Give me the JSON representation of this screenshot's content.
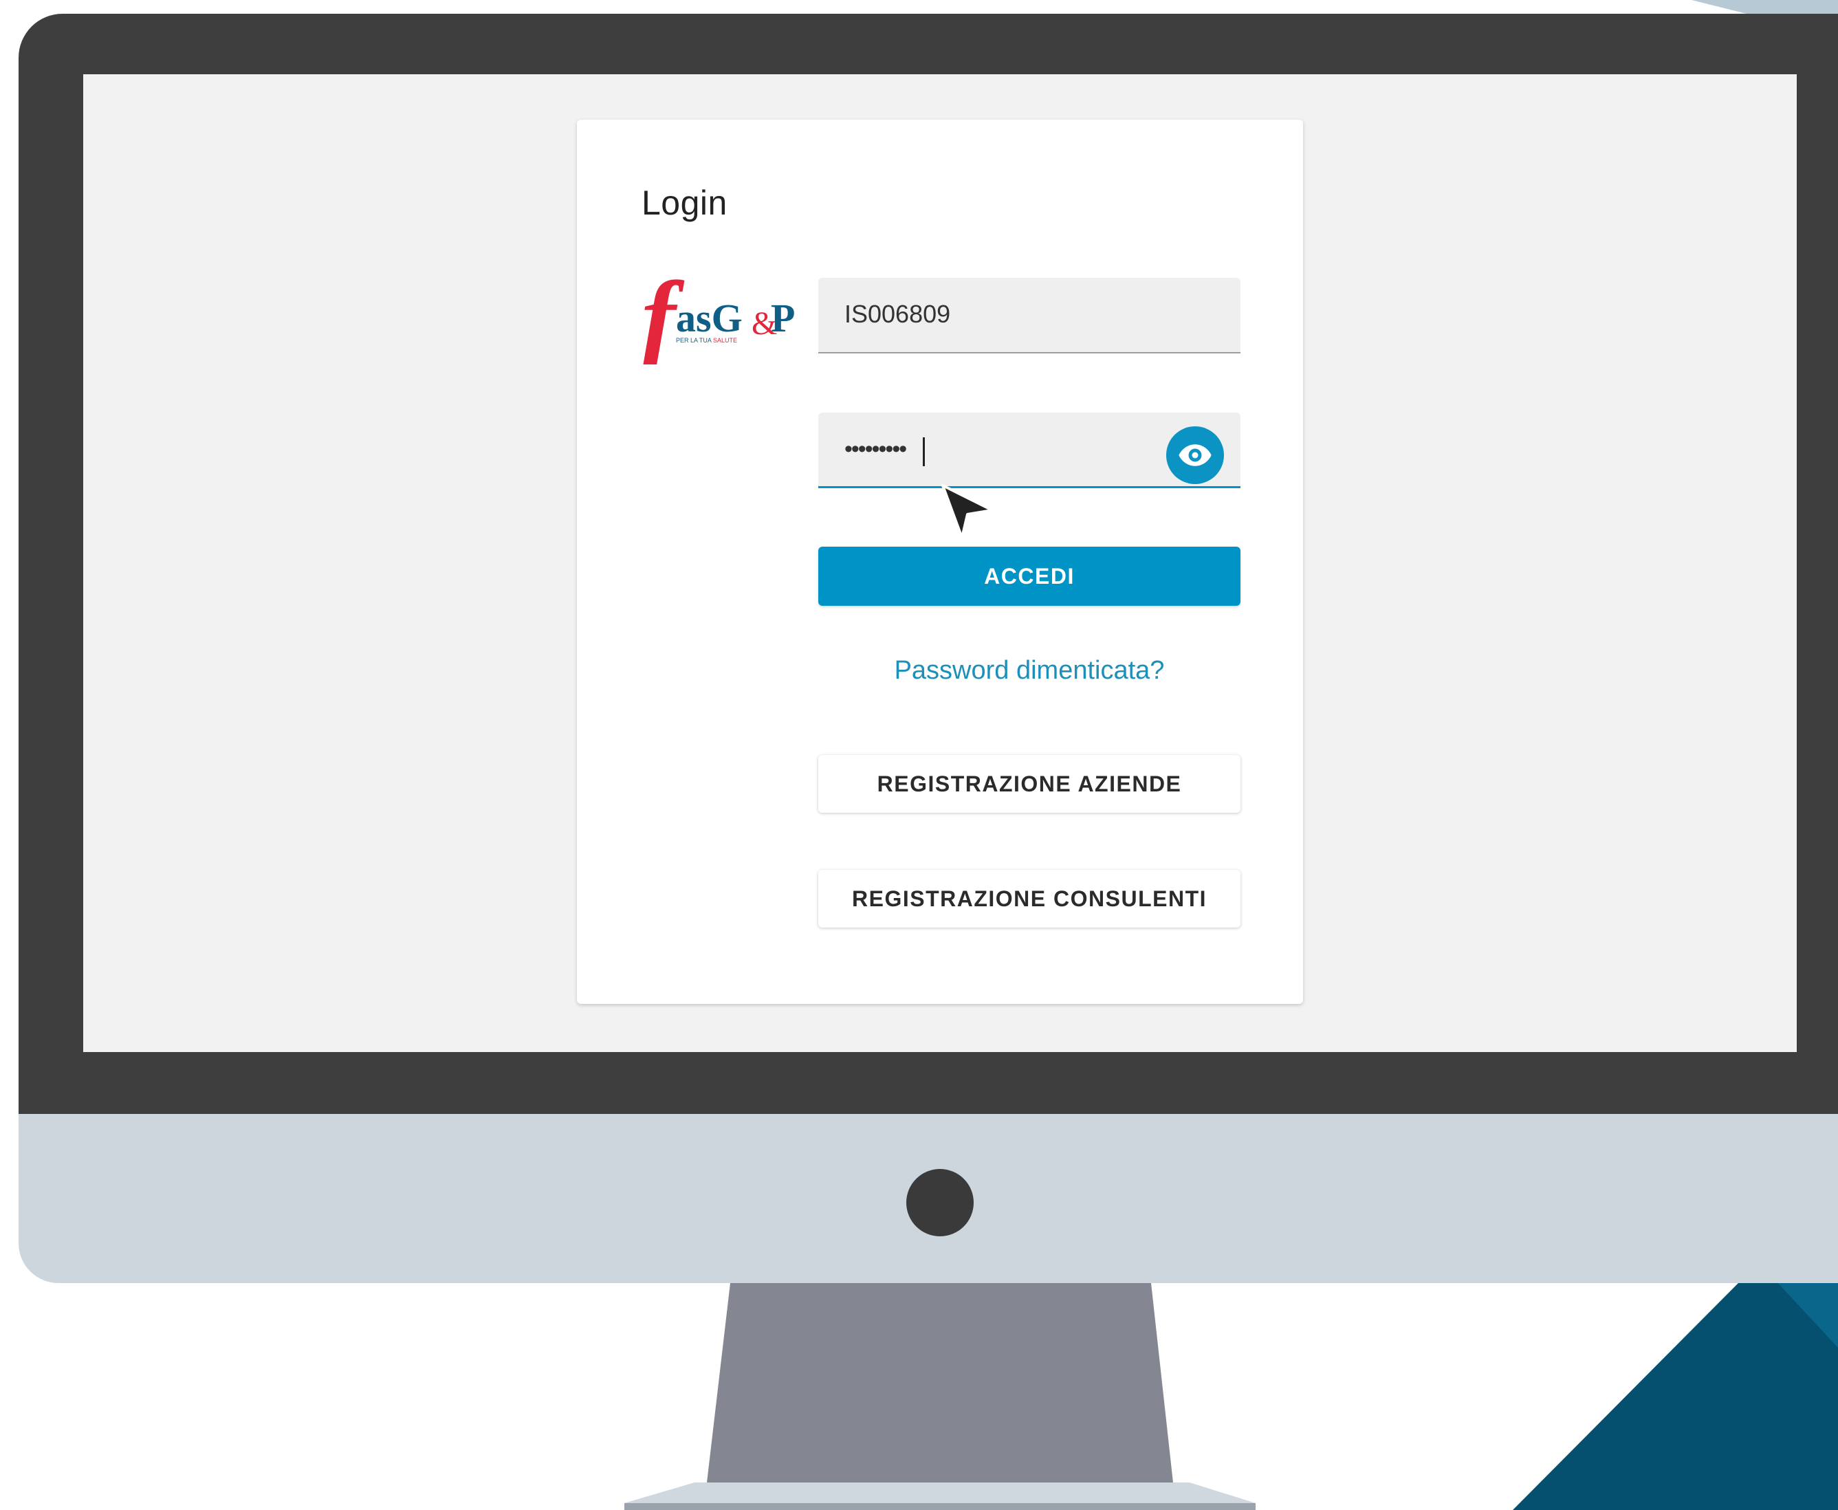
{
  "login": {
    "title": "Login",
    "logo_text": "fasG&P",
    "logo_tagline": "PER LA TUA SALUTE",
    "username_value": "IS006809",
    "password_value": "•••••••••",
    "toggle_password_icon": "eye-icon",
    "submit_label": "ACCEDI",
    "forgot_password_label": "Password dimenticata?",
    "register_companies_label": "REGISTRAZIONE AZIENDE",
    "register_consultants_label": "REGISTRAZIONE CONSULENTI"
  },
  "colors": {
    "accent": "#0093c6",
    "link": "#1c8fbb",
    "logo_red": "#e3263b",
    "logo_blue": "#0f5e86",
    "bezel": "#3e3e3e",
    "screen_bg": "#f2f2f2"
  }
}
